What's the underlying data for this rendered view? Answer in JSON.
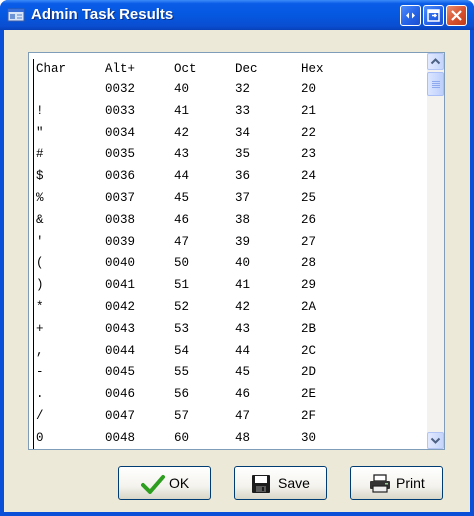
{
  "window": {
    "title": "Admin Task Results"
  },
  "table": {
    "headers": [
      "Char",
      "Alt+",
      "Oct",
      "Dec",
      "Hex"
    ],
    "rows": [
      [
        " ",
        "0032",
        "40",
        "32",
        "20"
      ],
      [
        "!",
        "0033",
        "41",
        "33",
        "21"
      ],
      [
        "\"",
        "0034",
        "42",
        "34",
        "22"
      ],
      [
        "#",
        "0035",
        "43",
        "35",
        "23"
      ],
      [
        "$",
        "0036",
        "44",
        "36",
        "24"
      ],
      [
        "%",
        "0037",
        "45",
        "37",
        "25"
      ],
      [
        "&",
        "0038",
        "46",
        "38",
        "26"
      ],
      [
        "'",
        "0039",
        "47",
        "39",
        "27"
      ],
      [
        "(",
        "0040",
        "50",
        "40",
        "28"
      ],
      [
        ")",
        "0041",
        "51",
        "41",
        "29"
      ],
      [
        "*",
        "0042",
        "52",
        "42",
        "2A"
      ],
      [
        "+",
        "0043",
        "53",
        "43",
        "2B"
      ],
      [
        ",",
        "0044",
        "54",
        "44",
        "2C"
      ],
      [
        "-",
        "0045",
        "55",
        "45",
        "2D"
      ],
      [
        ".",
        "0046",
        "56",
        "46",
        "2E"
      ],
      [
        "/",
        "0047",
        "57",
        "47",
        "2F"
      ],
      [
        "0",
        "0048",
        "60",
        "48",
        "30"
      ]
    ]
  },
  "buttons": {
    "ok": "OK",
    "save": "Save",
    "print": "Print"
  },
  "icons": {
    "app": "window-app-icon",
    "ok": "check-icon",
    "save": "floppy-disk-icon",
    "print": "printer-icon"
  },
  "colors": {
    "titlebar": "#0558e0",
    "client": "#ece9d8",
    "check": "#2e9e1f"
  }
}
